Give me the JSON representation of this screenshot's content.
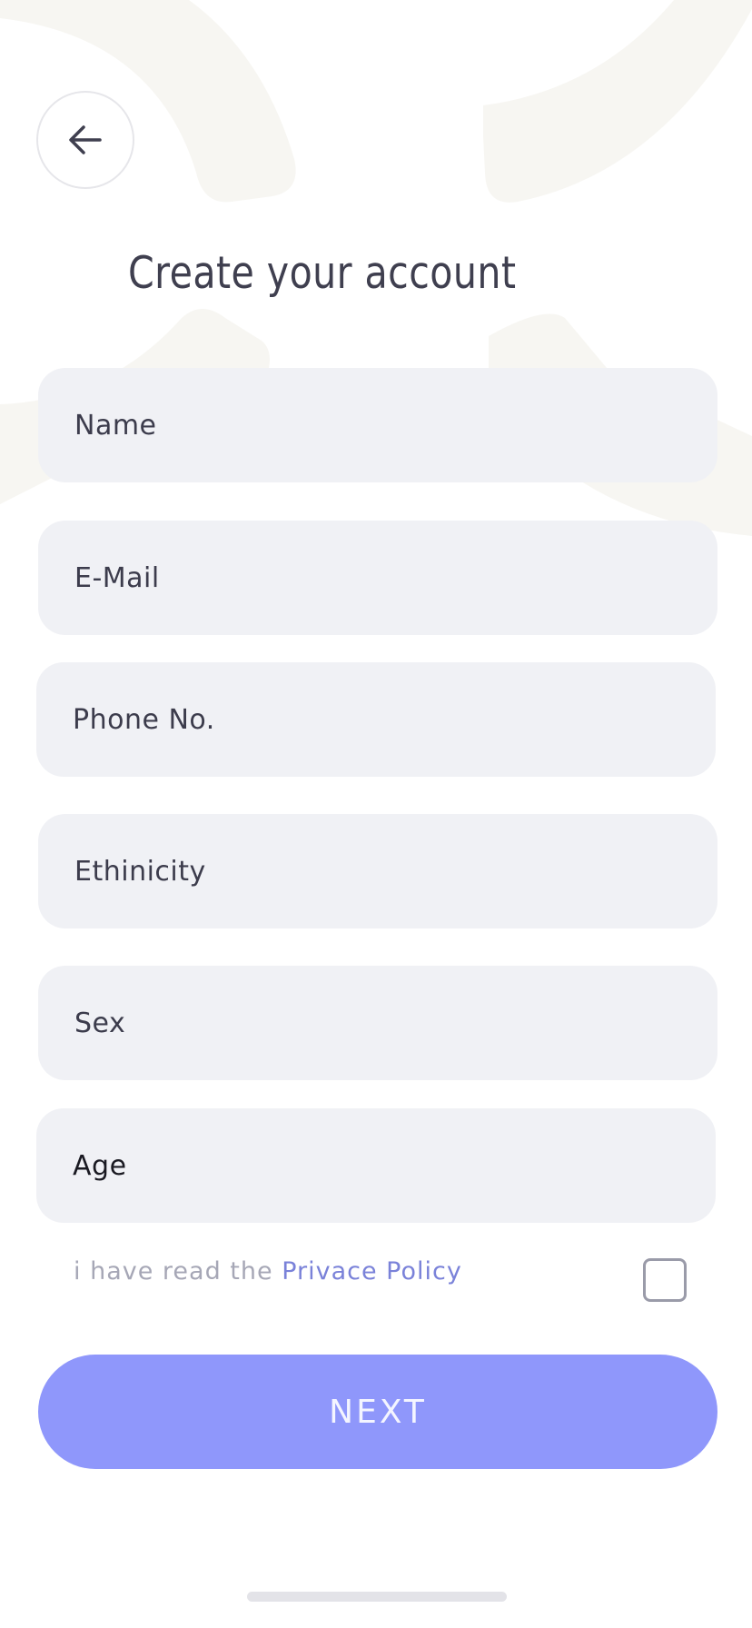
{
  "page": {
    "title": "Create your account"
  },
  "nav": {
    "back_icon": "arrow-left-icon"
  },
  "form": {
    "fields": [
      {
        "placeholder": "Name",
        "value": ""
      },
      {
        "placeholder": "E-Mail",
        "value": ""
      },
      {
        "placeholder": "Phone No.",
        "value": ""
      },
      {
        "placeholder": "Ethinicity",
        "value": ""
      },
      {
        "placeholder": "Sex",
        "value": ""
      },
      {
        "placeholder": "Age",
        "value": ""
      }
    ],
    "policy": {
      "prefix": "i have read the ",
      "link_label": "Privace Policy",
      "checked": false
    },
    "next_label": "NEXT"
  },
  "colors": {
    "accent": "#8f97fb",
    "field_bg": "#f0f1f5",
    "title": "#3f3f4f",
    "link": "#7a82d9",
    "muted_text": "#a6a7b6",
    "decor": "#f7f6f3"
  }
}
